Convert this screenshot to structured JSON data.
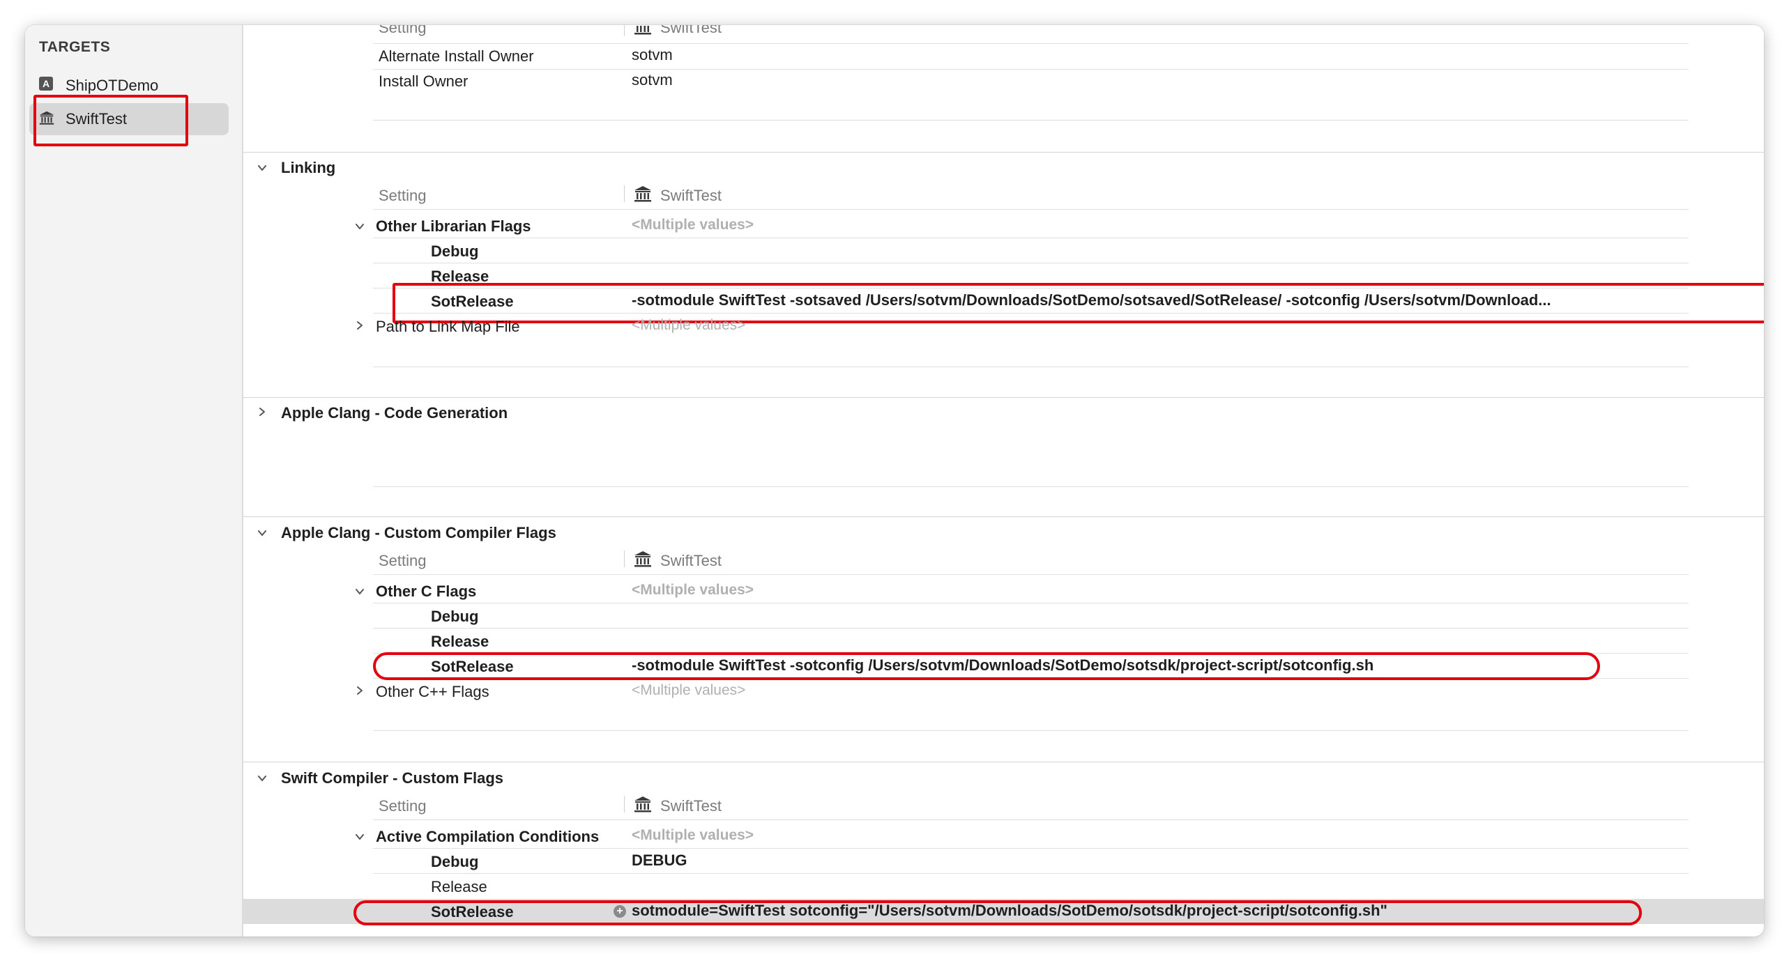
{
  "sidebar": {
    "section_title": "TARGETS",
    "targets": [
      {
        "label": "ShipOTDemo",
        "icon": "app-icon",
        "selected": false
      },
      {
        "label": "SwiftTest",
        "icon": "library-icon",
        "selected": true
      }
    ]
  },
  "deployment": {
    "col_setting": "Setting",
    "col_target": "SwiftTest",
    "rows": [
      {
        "name": "Alternate Install Owner",
        "value": "sotvm"
      },
      {
        "name": "Install Owner",
        "value": "sotvm"
      }
    ]
  },
  "linking": {
    "title": "Linking",
    "col_setting": "Setting",
    "col_target": "SwiftTest",
    "other_librarian_flags": {
      "name": "Other Librarian Flags",
      "value": "<Multiple values>",
      "debug": "Debug",
      "release": "Release",
      "sotrelease": "SotRelease",
      "sotrelease_value": "-sotmodule SwiftTest -sotsaved /Users/sotvm/Downloads/SotDemo/sotsaved/SotRelease/ -sotconfig /Users/sotvm/Download..."
    },
    "path_to_link_map": {
      "name": "Path to Link Map File",
      "value": "<Multiple values>"
    }
  },
  "clang_codegen": {
    "title": "Apple Clang - Code Generation"
  },
  "clang_custom": {
    "title": "Apple Clang - Custom Compiler Flags",
    "col_setting": "Setting",
    "col_target": "SwiftTest",
    "other_c_flags": {
      "name": "Other C Flags",
      "value": "<Multiple values>",
      "debug": "Debug",
      "release": "Release",
      "sotrelease": "SotRelease",
      "sotrelease_value": "-sotmodule SwiftTest -sotconfig /Users/sotvm/Downloads/SotDemo/sotsdk/project-script/sotconfig.sh"
    },
    "other_cpp_flags": {
      "name": "Other C++ Flags",
      "value": "<Multiple values>"
    }
  },
  "swift_custom": {
    "title": "Swift Compiler - Custom Flags",
    "col_setting": "Setting",
    "col_target": "SwiftTest",
    "active_conditions": {
      "name": "Active Compilation Conditions",
      "value": "<Multiple values>",
      "debug": "Debug",
      "debug_value": "DEBUG",
      "release": "Release",
      "sotrelease": "SotRelease",
      "sotrelease_value": "sotmodule=SwiftTest sotconfig=\"/Users/sotvm/Downloads/SotDemo/sotsdk/project-script/sotconfig.sh\""
    }
  },
  "colors": {
    "annotation": "#e3000f",
    "selection": "#d7d7d7",
    "sidebar_bg": "#f3f3f3"
  }
}
